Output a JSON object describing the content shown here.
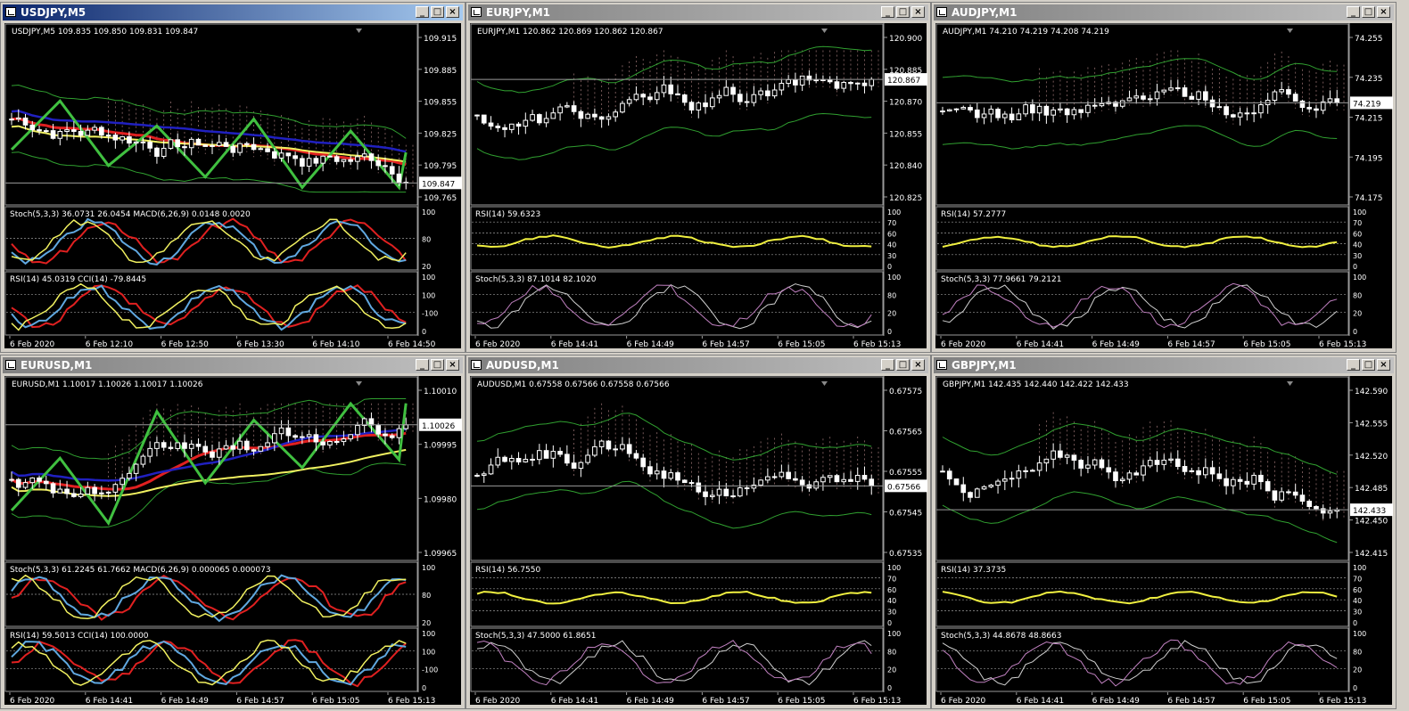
{
  "windows": [
    {
      "id": "usdjpy",
      "title": "USDJPY,M5",
      "active": true,
      "main_label": "USDJPY,M5  109.835 109.850 109.831 109.847",
      "price_labels": [
        "109.915",
        "109.885",
        "109.855",
        "109.825",
        "109.795",
        "109.765"
      ],
      "current_price": "109.847",
      "sub1_label": "Stoch(5,3,3) 36.0731 26.0454  MACD(6,26,9) 0.0148 0.0020",
      "sub1_levels": [
        "100",
        "80",
        "20"
      ],
      "sub2_label": "RSI(14) 45.0319  CCI(14) -79.8445",
      "sub2_levels": [
        "100",
        "100",
        "-100",
        "0"
      ],
      "time_labels": [
        "6 Feb 2020",
        "6 Feb 12:10",
        "6 Feb 12:50",
        "6 Feb 13:30",
        "6 Feb 14:10",
        "6 Feb 14:50"
      ]
    },
    {
      "id": "eurjpy",
      "title": "EURJPY,M1",
      "active": false,
      "main_label": "EURJPY,M1  120.862 120.869 120.862 120.867",
      "price_labels": [
        "120.900",
        "120.885",
        "120.870",
        "120.855",
        "120.840",
        "120.825"
      ],
      "current_price": "120.867",
      "sub1_label": "RSI(14) 59.6323",
      "sub1_levels": [
        "100",
        "70",
        "60",
        "40",
        "30",
        "0"
      ],
      "sub2_label": "Stoch(5,3,3) 87.1014 82.1020",
      "sub2_levels": [
        "100",
        "80",
        "20",
        "0"
      ],
      "time_labels": [
        "6 Feb 2020",
        "6 Feb 14:41",
        "6 Feb 14:49",
        "6 Feb 14:57",
        "6 Feb 15:05",
        "6 Feb 15:13"
      ]
    },
    {
      "id": "audjpy",
      "title": "AUDJPY,M1",
      "active": false,
      "main_label": "AUDJPY,M1  74.210 74.219 74.208 74.219",
      "price_labels": [
        "74.255",
        "74.235",
        "74.215",
        "74.195",
        "74.175"
      ],
      "current_price": "74.219",
      "sub1_label": "RSI(14) 57.2777",
      "sub1_levels": [
        "100",
        "70",
        "60",
        "40",
        "30",
        "0"
      ],
      "sub2_label": "Stoch(5,3,3) 77.9661 79.2121",
      "sub2_levels": [
        "100",
        "80",
        "20",
        "0"
      ],
      "time_labels": [
        "6 Feb 2020",
        "6 Feb 14:41",
        "6 Feb 14:49",
        "6 Feb 14:57",
        "6 Feb 15:05",
        "6 Feb 15:13"
      ]
    },
    {
      "id": "eurusd",
      "title": "EURUSD,M1",
      "active": false,
      "main_label": "EURUSD,M1  1.10017 1.10026 1.10017 1.10026",
      "price_labels": [
        "1.10010",
        "1.09995",
        "1.09980",
        "1.09965"
      ],
      "current_price": "1.10026",
      "sub1_label": "Stoch(5,3,3) 61.2245 61.7662  MACD(6,26,9) 0.000065 0.000073",
      "sub1_levels": [
        "100",
        "80",
        "20"
      ],
      "sub2_label": "RSI(14) 59.5013  CCI(14) 100.0000",
      "sub2_levels": [
        "100",
        "100",
        "-100",
        "0"
      ],
      "time_labels": [
        "6 Feb 2020",
        "6 Feb 14:41",
        "6 Feb 14:49",
        "6 Feb 14:57",
        "6 Feb 15:05",
        "6 Feb 15:13"
      ]
    },
    {
      "id": "audusd",
      "title": "AUDUSD,M1",
      "active": false,
      "main_label": "AUDUSD,M1  0.67558 0.67566 0.67558 0.67566",
      "price_labels": [
        "0.67575",
        "0.67565",
        "0.67555",
        "0.67545",
        "0.67535"
      ],
      "current_price": "0.67566",
      "sub1_label": "RSI(14) 56.7550",
      "sub1_levels": [
        "100",
        "70",
        "60",
        "40",
        "30",
        "0"
      ],
      "sub2_label": "Stoch(5,3,3) 47.5000 61.8651",
      "sub2_levels": [
        "100",
        "80",
        "20",
        "0"
      ],
      "time_labels": [
        "6 Feb 2020",
        "6 Feb 14:41",
        "6 Feb 14:49",
        "6 Feb 14:57",
        "6 Feb 15:05",
        "6 Feb 15:13"
      ]
    },
    {
      "id": "gbpjpy",
      "title": "GBPJPY,M1",
      "active": false,
      "main_label": "GBPJPY,M1  142.435 142.440 142.422 142.433",
      "price_labels": [
        "142.590",
        "142.555",
        "142.520",
        "142.485",
        "142.450",
        "142.415"
      ],
      "current_price": "142.433",
      "sub1_label": "RSI(14) 37.3735",
      "sub1_levels": [
        "100",
        "70",
        "60",
        "40",
        "30",
        "0"
      ],
      "sub2_label": "Stoch(5,3,3) 44.8678 48.8663",
      "sub2_levels": [
        "100",
        "80",
        "20",
        "0"
      ],
      "time_labels": [
        "6 Feb 2020",
        "6 Feb 14:41",
        "6 Feb 14:49",
        "6 Feb 14:57",
        "6 Feb 15:05",
        "6 Feb 15:13"
      ]
    }
  ],
  "colors": {
    "active_title": "#0a246a",
    "inactive_title": "#808080",
    "chart_bg": "#000000",
    "candle": "#ffffff",
    "ma_red": "#e02020",
    "ma_blue": "#2020c0",
    "ma_yellow": "#f0f060",
    "bands": "#30a030",
    "zigzag": "#40c040",
    "rsi_line": "#f0f040",
    "stoch_main": "#d0d0d0",
    "stoch_signal": "#c080c0",
    "cloud": "#c09090"
  }
}
